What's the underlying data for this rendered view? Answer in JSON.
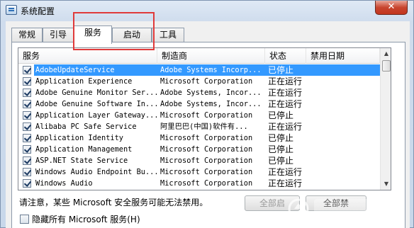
{
  "window": {
    "title": "系统配置",
    "close_glyph": "✕",
    "app_icon": "msconfig-icon"
  },
  "tabs": [
    {
      "label": "常规",
      "active": false
    },
    {
      "label": "引导",
      "active": false
    },
    {
      "label": "服务",
      "active": true
    },
    {
      "label": "启动",
      "active": false
    },
    {
      "label": "工具",
      "active": false
    }
  ],
  "services": {
    "columns": [
      "服务",
      "制造商",
      "状态",
      "禁用日期"
    ],
    "rows": [
      {
        "service": "AdobeUpdateService",
        "manufacturer": "Adobe Systems Incorp...",
        "status": "已停止",
        "checked": true,
        "selected": true
      },
      {
        "service": "Application Experience",
        "manufacturer": "Microsoft Corporation",
        "status": "正在运行",
        "checked": true,
        "selected": false
      },
      {
        "service": "Adobe Genuine Monitor Ser...",
        "manufacturer": "Adobe Systems, Incor...",
        "status": "正在运行",
        "checked": true,
        "selected": false
      },
      {
        "service": "Adobe Genuine Software In...",
        "manufacturer": "Adobe Systems, Incor...",
        "status": "正在运行",
        "checked": true,
        "selected": false
      },
      {
        "service": "Application Layer Gateway...",
        "manufacturer": "Microsoft Corporation",
        "status": "已停止",
        "checked": true,
        "selected": false
      },
      {
        "service": "Alibaba PC Safe Service",
        "manufacturer": "阿里巴巴(中国)软件有...",
        "status": "正在运行",
        "checked": true,
        "selected": false
      },
      {
        "service": "Application Identity",
        "manufacturer": "Microsoft Corporation",
        "status": "已停止",
        "checked": true,
        "selected": false
      },
      {
        "service": "Application Management",
        "manufacturer": "Microsoft Corporation",
        "status": "已停止",
        "checked": true,
        "selected": false
      },
      {
        "service": "ASP.NET State Service",
        "manufacturer": "Microsoft Corporation",
        "status": "已停止",
        "checked": true,
        "selected": false
      },
      {
        "service": "Windows Audio Endpoint Bu...",
        "manufacturer": "Microsoft Corporation",
        "status": "正在运行",
        "checked": true,
        "selected": false
      },
      {
        "service": "Windows Audio",
        "manufacturer": "Microsoft Corporation",
        "status": "正在运行",
        "checked": true,
        "selected": false
      }
    ]
  },
  "scrollbar": {
    "up_glyph": "▲",
    "down_glyph": "▼"
  },
  "note": "请注意，某些 Microsoft 安全服务可能无法禁用。",
  "buttons": {
    "enable_all": "全部启",
    "disable_all": "全部禁"
  },
  "hide_microsoft": {
    "label": "隐藏所有 Microsoft 服务(H)",
    "checked": false
  },
  "colors": {
    "selection": "#3399ff",
    "highlight_box": "#e03a3a",
    "close_button": "#c8452f"
  }
}
